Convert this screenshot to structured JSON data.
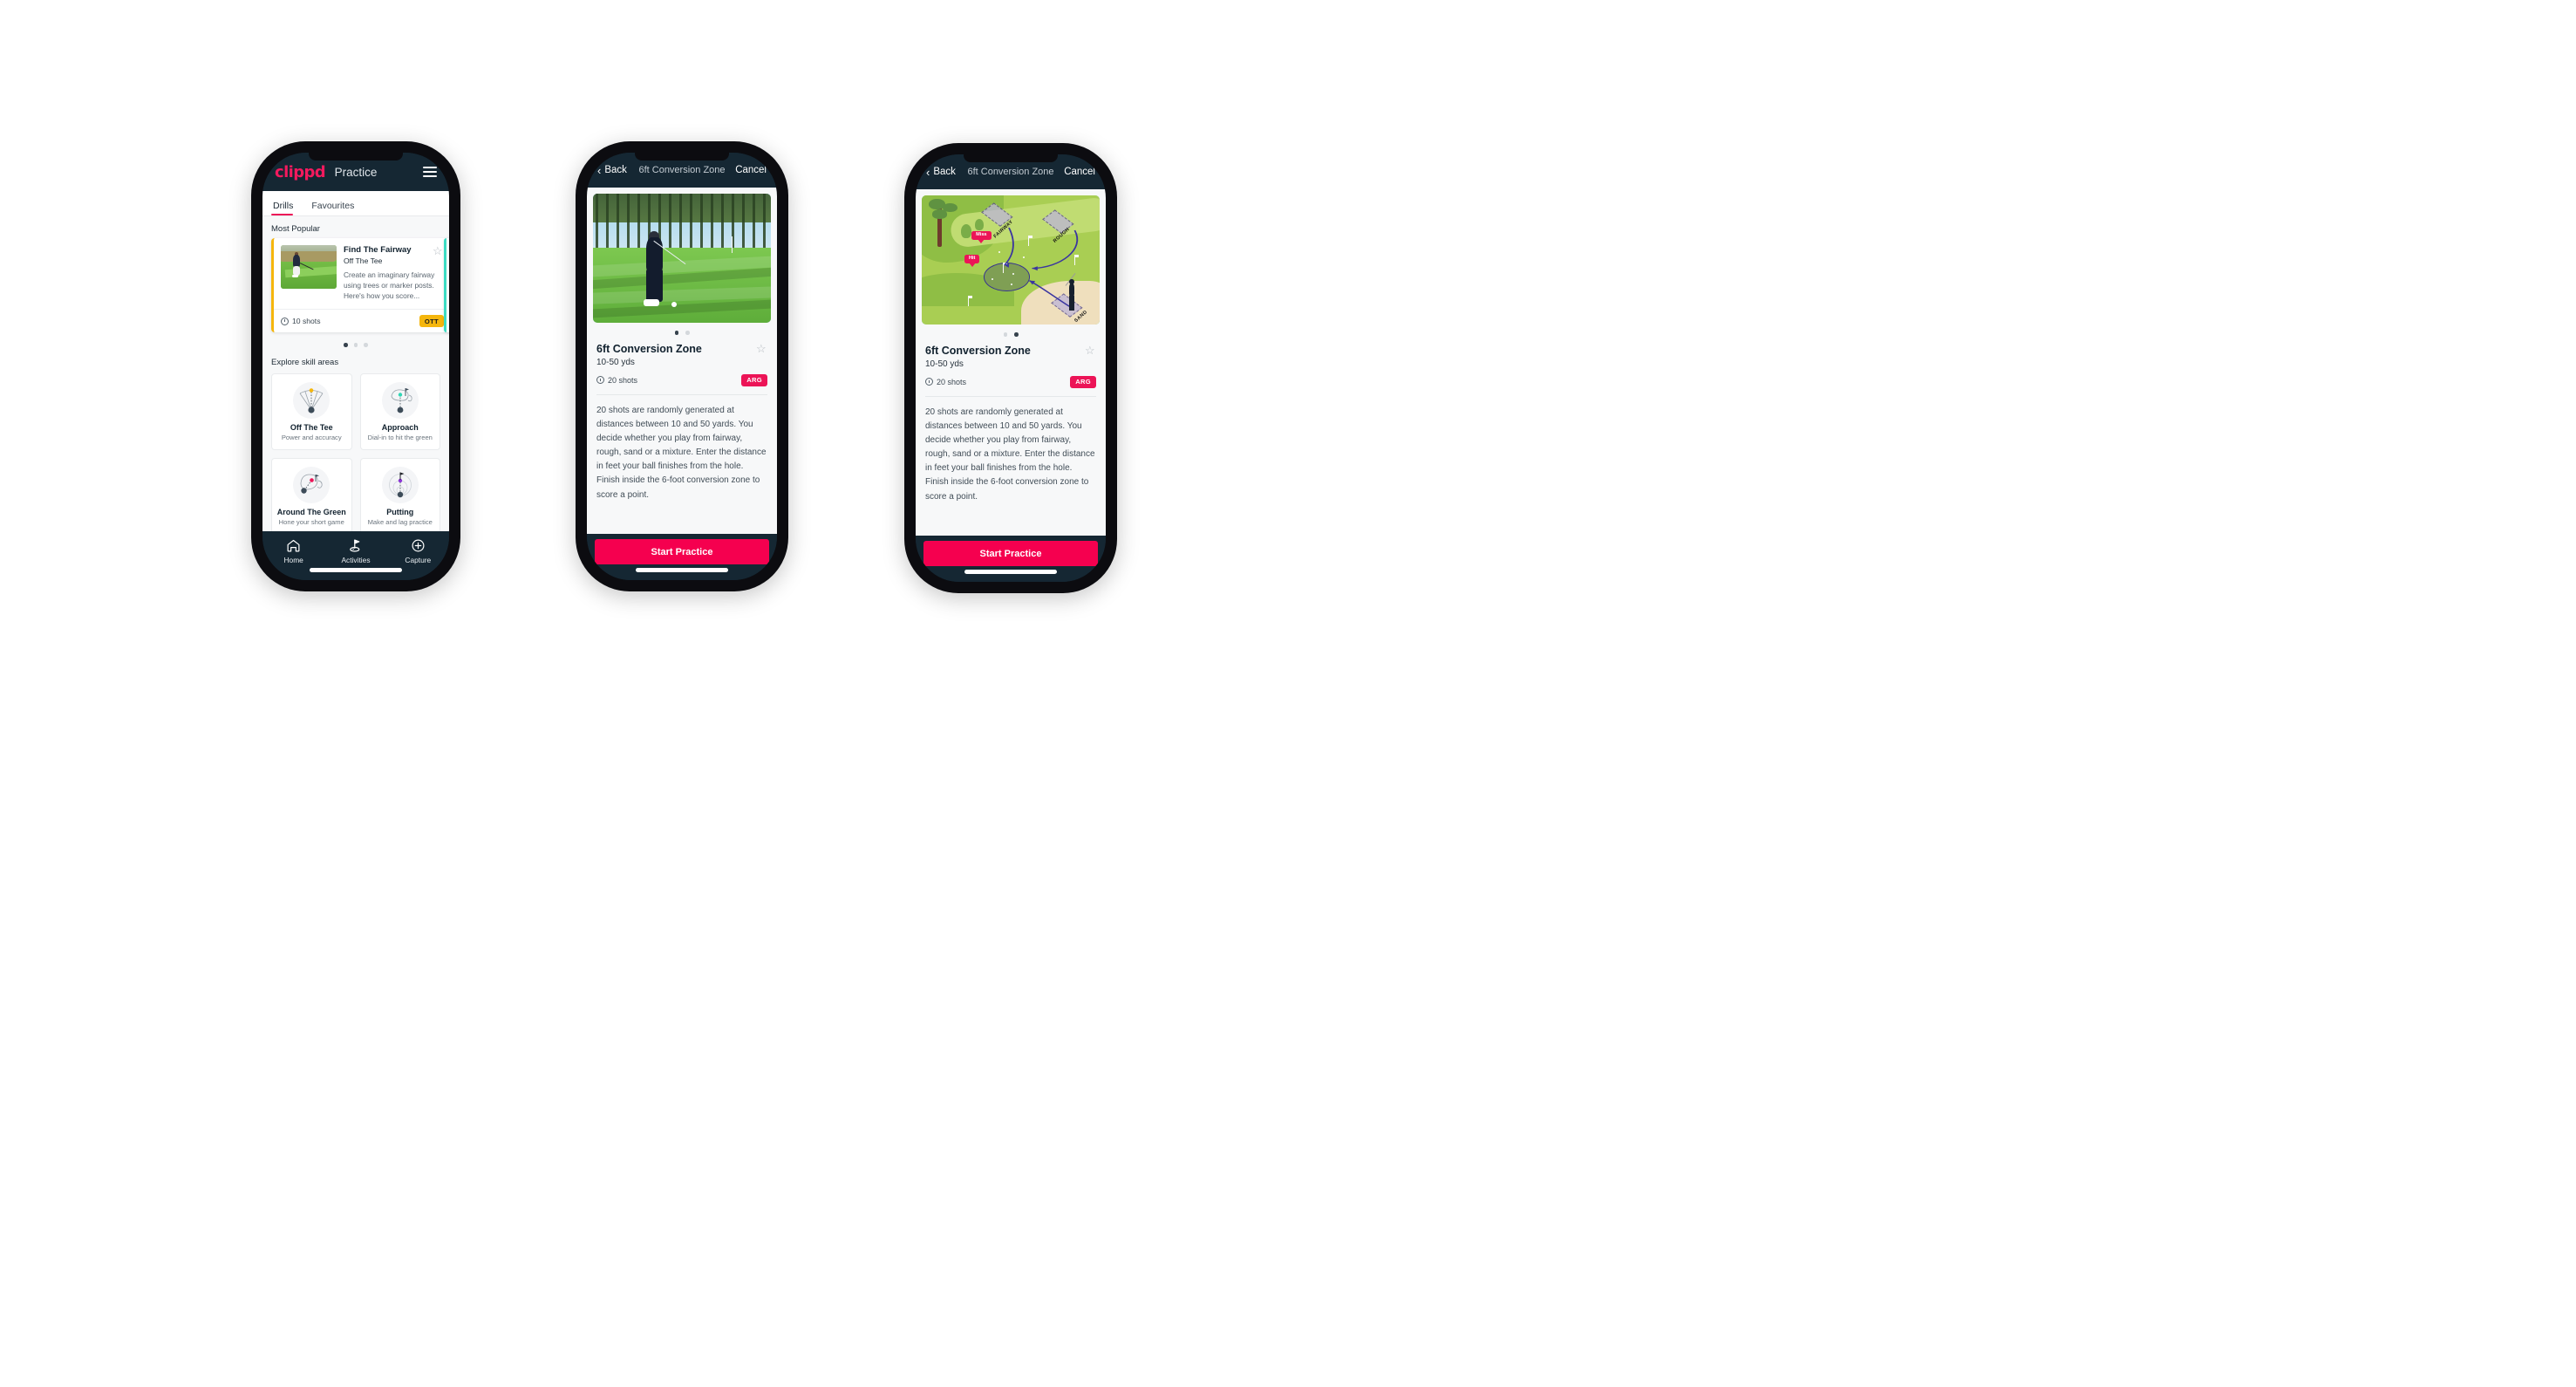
{
  "app": {
    "brand": "clippd",
    "accent_pink": "#ec1457",
    "cta_pink": "#f5004f",
    "dark_navy": "#152733",
    "ott_yellow": "#f5b60d",
    "arg_pink": "#ec1457",
    "teal": "#3ddcc3"
  },
  "phone1": {
    "header": {
      "brand": "clippd",
      "title": "Practice",
      "menu_icon": "hamburger-menu-icon"
    },
    "tabs": [
      {
        "label": "Drills",
        "active": true
      },
      {
        "label": "Favourites",
        "active": false
      }
    ],
    "most_popular": {
      "section_title": "Most Popular",
      "card": {
        "title": "Find The Fairway",
        "subtitle": "Off The Tee",
        "description": "Create an imaginary fairway using trees or marker posts. Here's how you score...",
        "shots": "10 shots",
        "badge": "OTT",
        "favourite_icon": "star-outline-icon",
        "clock_icon": "clock-icon",
        "accent": "#f5b60d"
      },
      "carousel_dots": 3,
      "carousel_active_index": 0
    },
    "explore": {
      "section_title": "Explore skill areas",
      "cards": [
        {
          "name": "Off The Tee",
          "sub": "Power and accuracy",
          "icon": "tee-shot-dispersion-icon",
          "dot": "#f5b60d"
        },
        {
          "name": "Approach",
          "sub": "Dial-in to hit the green",
          "icon": "approach-green-icon",
          "dot": "#3ddcc3"
        },
        {
          "name": "Around The Green",
          "sub": "Hone your short game",
          "icon": "chip-around-green-icon",
          "dot": "#ec1457"
        },
        {
          "name": "Putting",
          "sub": "Make and lag practice",
          "icon": "putting-rings-icon",
          "dot": "#8b35d6"
        }
      ]
    },
    "bottom_nav": [
      {
        "label": "Home",
        "icon": "home-icon",
        "active": false
      },
      {
        "label": "Activities",
        "icon": "golf-flag-icon",
        "active": true
      },
      {
        "label": "Capture",
        "icon": "plus-circle-icon",
        "active": false
      }
    ]
  },
  "phone2": {
    "header": {
      "back": "Back",
      "title": "6ft Conversion Zone",
      "cancel": "Cancel",
      "back_icon": "chevron-left-icon"
    },
    "media": {
      "type": "video-thumbnail",
      "alt": "golfer chipping on fairway towards green"
    },
    "carousel_dots": 2,
    "carousel_active_index": 0,
    "detail": {
      "title": "6ft Conversion Zone",
      "yards": "10-50 yds",
      "shots": "20 shots",
      "badge": "ARG",
      "favourite_icon": "star-outline-icon",
      "clock_icon": "clock-icon",
      "description": "20 shots are randomly generated at distances between 10 and 50 yards. You decide whether you play from fairway, rough, sand or a mixture. Enter the distance in feet your ball finishes from the hole. Finish inside the 6-foot conversion zone to score a point."
    },
    "cta": "Start Practice"
  },
  "phone3": {
    "header": {
      "back": "Back",
      "title": "6ft Conversion Zone",
      "cancel": "Cancel",
      "back_icon": "chevron-left-icon"
    },
    "media": {
      "type": "course-diagram",
      "labels": [
        "FAIRWAY",
        "ROUGH",
        "SAND"
      ],
      "markers": [
        "Miss",
        "Hit"
      ]
    },
    "carousel_dots": 2,
    "carousel_active_index": 1,
    "detail": {
      "title": "6ft Conversion Zone",
      "yards": "10-50 yds",
      "shots": "20 shots",
      "badge": "ARG",
      "favourite_icon": "star-outline-icon",
      "clock_icon": "clock-icon",
      "description": "20 shots are randomly generated at distances between 10 and 50 yards. You decide whether you play from fairway, rough, sand or a mixture. Enter the distance in feet your ball finishes from the hole. Finish inside the 6-foot conversion zone to score a point."
    },
    "cta": "Start Practice"
  }
}
